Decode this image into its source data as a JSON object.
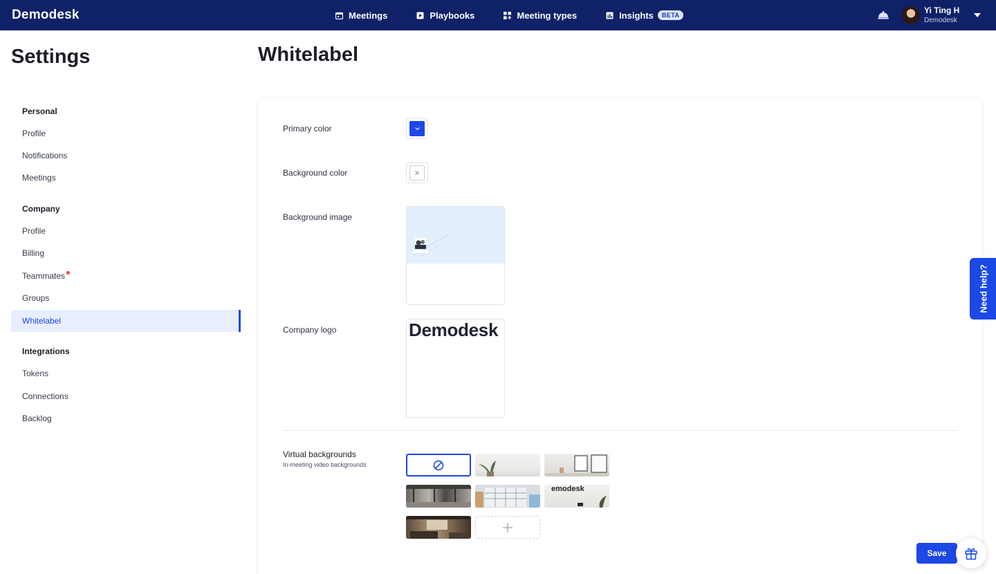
{
  "app": {
    "logo_text": "Demodesk"
  },
  "nav": {
    "items": [
      {
        "label": "Meetings",
        "icon": "calendar-icon"
      },
      {
        "label": "Playbooks",
        "icon": "playbook-icon"
      },
      {
        "label": "Meeting types",
        "icon": "grid-icon"
      },
      {
        "label": "Insights",
        "icon": "chart-icon",
        "badge": "BETA"
      }
    ]
  },
  "user": {
    "name": "Yi Ting H",
    "org": "Demodesk"
  },
  "sidebar": {
    "title": "Settings",
    "groups": [
      {
        "label": "Personal",
        "items": [
          "Profile",
          "Notifications",
          "Meetings"
        ]
      },
      {
        "label": "Company",
        "items": [
          "Profile",
          "Billing",
          "Teammates",
          "Groups",
          "Whitelabel"
        ]
      },
      {
        "label": "Integrations",
        "items": [
          "Tokens",
          "Connections",
          "Backlog"
        ]
      }
    ],
    "active_item": "Whitelabel"
  },
  "main": {
    "title": "Whitelabel",
    "primary_color_label": "Primary color",
    "primary_color": "#1c48e6",
    "background_color_label": "Background color",
    "background_color": "none",
    "background_image_label": "Background image",
    "company_logo_label": "Company logo",
    "company_logo_text": "Demodesk",
    "virtual_backgrounds_title": "Virtual backgrounds",
    "virtual_backgrounds_subtitle": "In-meeting video backgrounds",
    "save_label": "Save"
  },
  "help": {
    "label": "Need help?"
  },
  "colors": {
    "topbar": "#0f2167",
    "accent": "#1c48e6",
    "active_bg": "#e8eeff",
    "notification_dot": "#e5484d"
  }
}
